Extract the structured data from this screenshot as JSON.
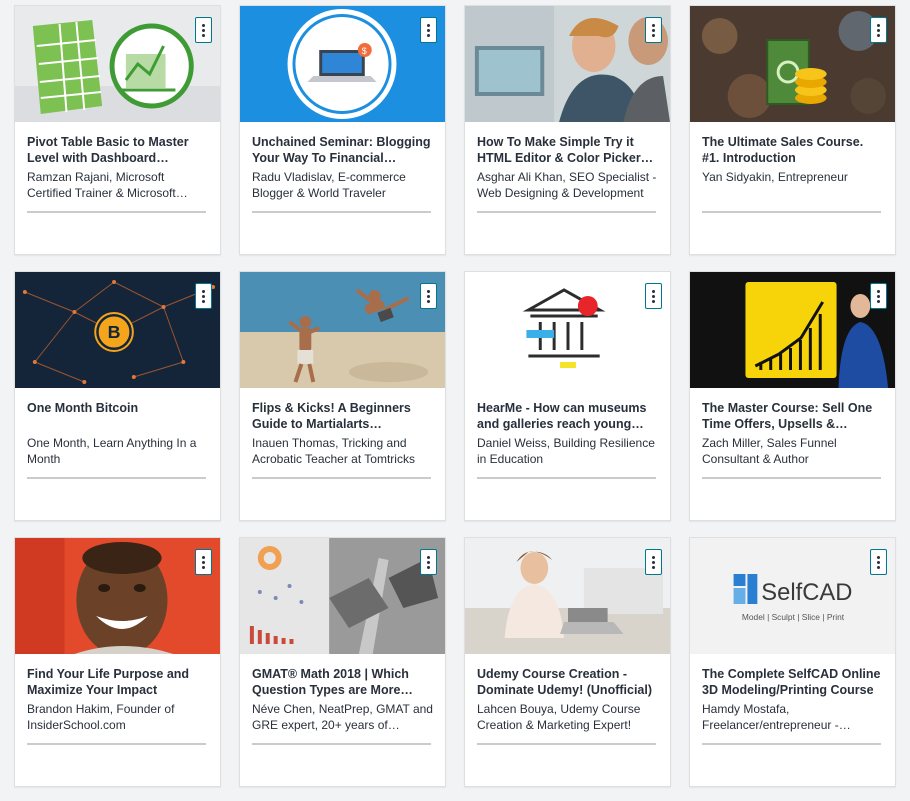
{
  "courses": [
    {
      "title": "Pivot Table Basic to Master Level with Dashboard…",
      "author": "Ramzan Rajani, Microsoft Certified Trainer & Microsoft…"
    },
    {
      "title": "Unchained Seminar: Blogging Your Way To Financial…",
      "author": "Radu Vladislav, E-commerce Blogger & World Traveler"
    },
    {
      "title": "How To Make Simple Try it HTML Editor & Color Picker…",
      "author": "Asghar Ali Khan, SEO Specialist - Web Designing & Development"
    },
    {
      "title": "The Ultimate Sales Course. #1. Introduction",
      "author": "Yan Sidyakin, Entrepreneur"
    },
    {
      "title": "One Month Bitcoin",
      "author": "One Month, Learn Anything In a Month"
    },
    {
      "title": "Flips & Kicks! A Beginners Guide to Martialarts…",
      "author": "Inauen Thomas, Tricking and Acrobatic Teacher at Tomtricks"
    },
    {
      "title": "HearMe - How can museums and galleries reach young…",
      "author": "Daniel Weiss, Building Resilience in Education"
    },
    {
      "title": "The Master Course: Sell One Time Offers, Upsells &…",
      "author": "Zach Miller, Sales Funnel Consultant & Author"
    },
    {
      "title": "Find Your Life Purpose and Maximize Your Impact",
      "author": "Brandon Hakim, Founder of InsiderSchool.com"
    },
    {
      "title": "GMAT® Math 2018 | Which Question Types are More…",
      "author": "Néve Chen, NeatPrep, GMAT and GRE expert, 20+ years of…"
    },
    {
      "title": "Udemy Course Creation - Dominate Udemy! (Unofficial)",
      "author": "Lahcen Bouya, Udemy Course Creation & Marketing Expert!"
    },
    {
      "title": "The Complete SelfCAD Online 3D Modeling/Printing Course",
      "author": "Hamdy Mostafa, Freelancer/entrepreneur -…"
    }
  ],
  "thumbs": {
    "bitcoin_symbol": "B",
    "selfcad_logo": "SelfCAD",
    "selfcad_tagline": "Model | Sculpt | Slice | Print"
  },
  "colors": {
    "menu_border": "#007791",
    "text": "#29303b"
  }
}
